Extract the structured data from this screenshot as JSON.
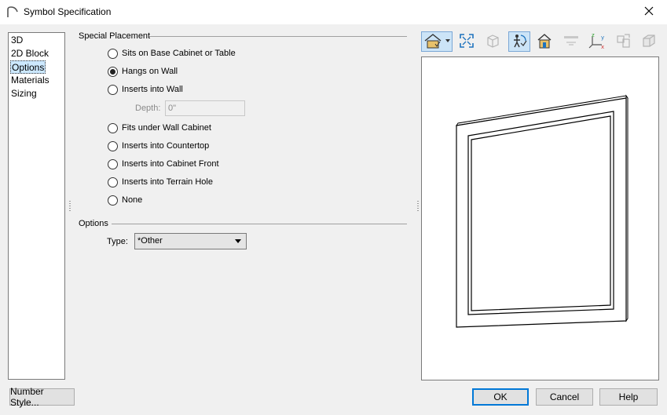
{
  "window": {
    "title": "Symbol Specification",
    "icon": "app-arch-icon",
    "close_icon": "close-icon"
  },
  "nav": {
    "items": [
      {
        "label": "3D",
        "selected": false
      },
      {
        "label": "2D Block",
        "selected": false
      },
      {
        "label": "Options",
        "selected": true
      },
      {
        "label": "Materials",
        "selected": false
      },
      {
        "label": "Sizing",
        "selected": false
      }
    ]
  },
  "special_placement": {
    "label": "Special Placement",
    "options": [
      {
        "label": "Sits on Base Cabinet or Table",
        "checked": false
      },
      {
        "label": "Hangs on Wall",
        "checked": true
      },
      {
        "label": "Inserts into Wall",
        "checked": false
      },
      {
        "label": "Fits under Wall Cabinet",
        "checked": false
      },
      {
        "label": "Inserts into Countertop",
        "checked": false
      },
      {
        "label": "Inserts into Cabinet Front",
        "checked": false
      },
      {
        "label": "Inserts into Terrain Hole",
        "checked": false
      },
      {
        "label": "None",
        "checked": false
      }
    ],
    "depth": {
      "label": "Depth:",
      "value": "0\"",
      "enabled": false
    }
  },
  "options": {
    "label": "Options",
    "type_label": "Type:",
    "type_value": "*Other"
  },
  "toolbar": {
    "buttons": [
      {
        "icon": "camera-view-dropdown-icon",
        "active": true
      },
      {
        "icon": "fill-window-icon",
        "active": false
      },
      {
        "icon": "orthographic-icon",
        "active": false,
        "disabled": true
      },
      {
        "icon": "rotate-view-icon",
        "active": true
      },
      {
        "icon": "house-elevation-icon",
        "active": false
      },
      {
        "icon": "floor-view-icon",
        "active": false,
        "disabled": true
      },
      {
        "icon": "xyz-axis-icon",
        "active": false
      },
      {
        "icon": "copy-view-icon",
        "active": false,
        "disabled": true
      },
      {
        "icon": "box-3d-icon",
        "active": false,
        "disabled": true
      }
    ]
  },
  "buttons": {
    "number_style": "Number Style...",
    "ok": "OK",
    "cancel": "Cancel",
    "help": "Help"
  },
  "colors": {
    "accent": "#0078d7",
    "selection": "#cce8ff",
    "dialog_bg": "#f0f0f0"
  }
}
